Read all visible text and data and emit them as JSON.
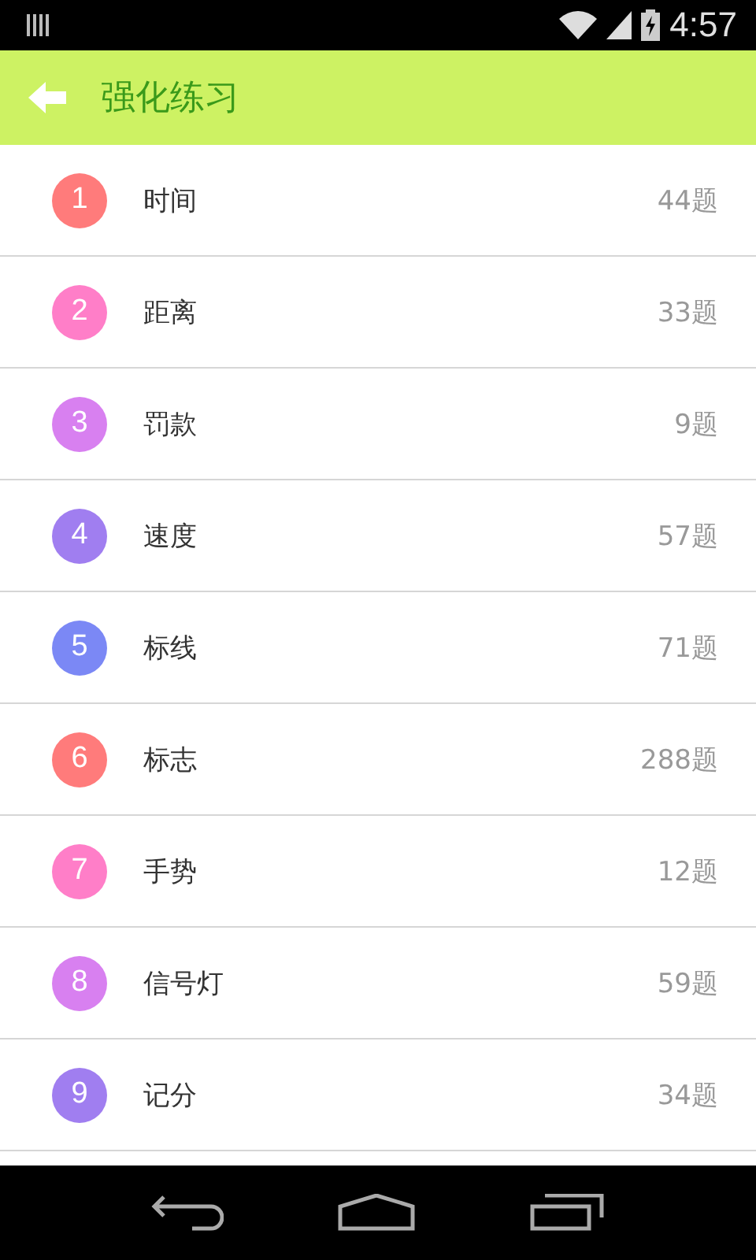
{
  "status_bar": {
    "time": "4:57"
  },
  "header": {
    "title": "强化练习"
  },
  "items": [
    {
      "number": "1",
      "name": "时间",
      "count": "44题",
      "color": "#ff7b7b"
    },
    {
      "number": "2",
      "name": "距离",
      "count": "33题",
      "color": "#ff7ec8"
    },
    {
      "number": "3",
      "name": "罚款",
      "count": "9题",
      "color": "#d880f0"
    },
    {
      "number": "4",
      "name": "速度",
      "count": "57题",
      "color": "#a07ef0"
    },
    {
      "number": "5",
      "name": "标线",
      "count": "71题",
      "color": "#7b88f5"
    },
    {
      "number": "6",
      "name": "标志",
      "count": "288题",
      "color": "#ff7b7b"
    },
    {
      "number": "7",
      "name": "手势",
      "count": "12题",
      "color": "#ff7ec8"
    },
    {
      "number": "8",
      "name": "信号灯",
      "count": "59题",
      "color": "#d880f0"
    },
    {
      "number": "9",
      "name": "记分",
      "count": "34题",
      "color": "#a07ef0"
    }
  ]
}
